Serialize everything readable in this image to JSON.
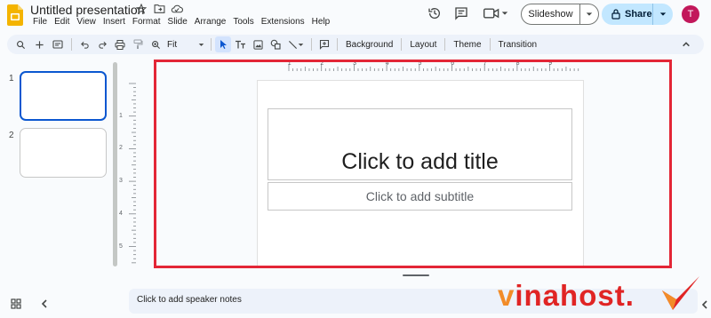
{
  "app": {
    "title": "Untitled presentation",
    "menu": [
      "File",
      "Edit",
      "View",
      "Insert",
      "Format",
      "Slide",
      "Arrange",
      "Tools",
      "Extensions",
      "Help"
    ]
  },
  "header": {
    "slideshow_label": "Slideshow",
    "share_label": "Share",
    "avatar_initial": "T"
  },
  "toolbar": {
    "zoom_value": "Fit",
    "background_label": "Background",
    "layout_label": "Layout",
    "theme_label": "Theme",
    "transition_label": "Transition"
  },
  "filmstrip": {
    "slides": [
      {
        "number": "1",
        "selected": true
      },
      {
        "number": "2",
        "selected": false
      }
    ]
  },
  "slide": {
    "title_placeholder": "Click to add title",
    "subtitle_placeholder": "Click to add subtitle"
  },
  "ruler": {
    "top_labels": [
      "1",
      "2",
      "3",
      "4",
      "5",
      "6",
      "7",
      "8",
      "9"
    ],
    "left_labels": [
      "1",
      "2",
      "3",
      "4",
      "5"
    ]
  },
  "notes": {
    "placeholder": "Click to add speaker notes"
  },
  "watermark": {
    "text_v": "v",
    "text_rest": "inahost",
    "text_dot": "."
  },
  "colors": {
    "accent": "#0b57d0",
    "share_bg": "#c2e7ff",
    "highlight_frame": "#e32636",
    "avatar": "#c2185b",
    "logo": "#f4b400"
  }
}
